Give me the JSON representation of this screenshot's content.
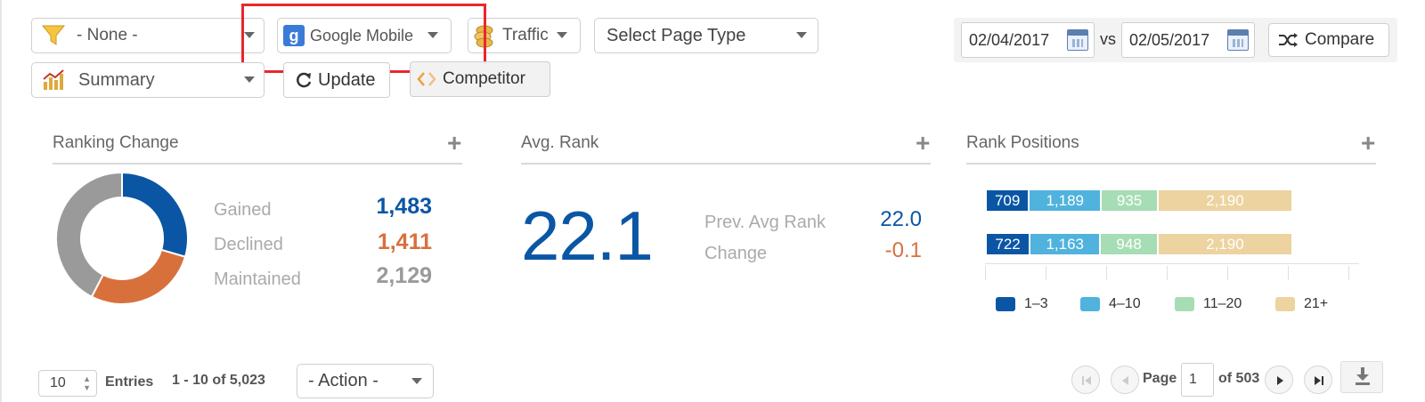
{
  "filters": {
    "filter_value": "- None -",
    "engine_value": "Google Mobile",
    "traffic_value": "Traffic",
    "page_type_value": "Select Page Type",
    "view_value": "Summary",
    "update_label": "Update",
    "competitor_label": "Competitor"
  },
  "dates": {
    "date1": "02/04/2017",
    "vs_label": "vs",
    "date2": "02/05/2017",
    "compare_label": "Compare"
  },
  "ranking_change": {
    "title": "Ranking Change",
    "gained_label": "Gained",
    "gained_value": "1,483",
    "declined_label": "Declined",
    "declined_value": "1,411",
    "maintained_label": "Maintained",
    "maintained_value": "2,129",
    "colors": {
      "gained": "#0b56a4",
      "declined": "#d8703c",
      "maintained": "#9a9a9a"
    }
  },
  "avg_rank": {
    "title": "Avg. Rank",
    "value": "22.1",
    "prev_label": "Prev. Avg Rank",
    "prev_value": "22.0",
    "change_label": "Change",
    "change_value": "-0.1"
  },
  "rank_positions": {
    "title": "Rank Positions",
    "rows": [
      {
        "segments": [
          {
            "label": "709",
            "value": 709
          },
          {
            "label": "1,189",
            "value": 1189
          },
          {
            "label": "935",
            "value": 935
          },
          {
            "label": "2,190",
            "value": 2190
          }
        ]
      },
      {
        "segments": [
          {
            "label": "722",
            "value": 722
          },
          {
            "label": "1,163",
            "value": 1163
          },
          {
            "label": "948",
            "value": 948
          },
          {
            "label": "2,190",
            "value": 2190
          }
        ]
      }
    ],
    "legend": [
      {
        "label": "1–3",
        "color": "#0b56a4"
      },
      {
        "label": "4–10",
        "color": "#4fb3dd"
      },
      {
        "label": "11–20",
        "color": "#a6ddb4"
      },
      {
        "label": "21+",
        "color": "#ecd39f"
      }
    ]
  },
  "footer": {
    "entries_value": "10",
    "entries_label": "Entries",
    "range_text": "1 - 10 of 5,023",
    "action_value": "- Action -",
    "page_label": "Page",
    "page_value": "1",
    "of_pages": "of 503"
  }
}
